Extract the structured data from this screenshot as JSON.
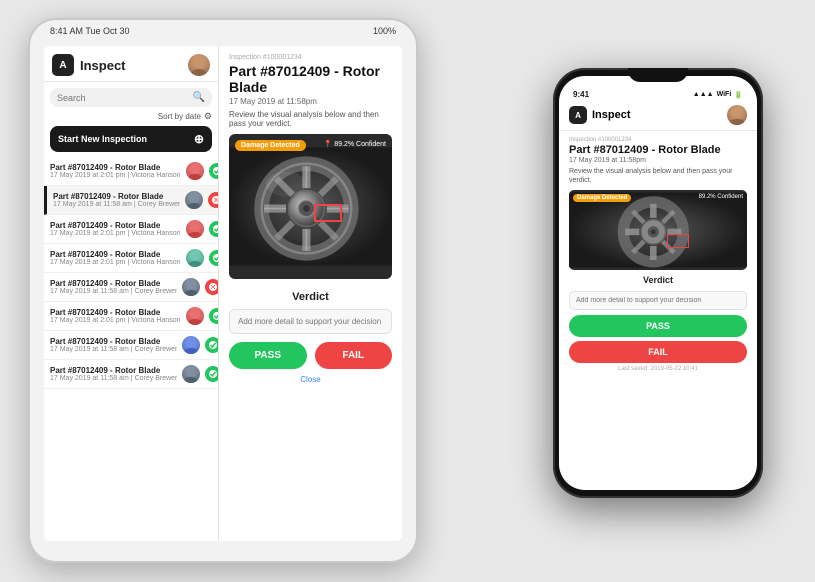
{
  "app": {
    "name": "Inspect",
    "logo": "A"
  },
  "tablet": {
    "status_bar": {
      "time": "8:41 AM  Tue Oct 30",
      "battery": "100%"
    }
  },
  "phone": {
    "status_bar": {
      "time": "9:41",
      "signal": "▲▲▲",
      "wifi": "WiFi",
      "battery": "100%"
    }
  },
  "search": {
    "placeholder": "Search",
    "sort_label": "Sort by date"
  },
  "start_inspection": {
    "label": "Start New Inspection"
  },
  "list_items": [
    {
      "title": "Part #87012409 - Rotor Blade",
      "sub": "17 May 2019 at 2:01 pm | Victoria Hanson",
      "avatar_class": "av-red",
      "status": "green",
      "active": false
    },
    {
      "title": "Part #87012409 - Rotor Blade",
      "sub": "17 May 2019 at 11:58 am | Corey Brewer",
      "avatar_class": "av-dark",
      "status": "red",
      "active": true
    },
    {
      "title": "Part #87012409 - Rotor Blade",
      "sub": "17 May 2019 at 2:01 pm | Victoria Hanson",
      "avatar_class": "av-red",
      "status": "green",
      "active": false
    },
    {
      "title": "Part #87012409 - Rotor Blade",
      "sub": "17 May 2019 at 2:01 pm | Victoria Hanson",
      "avatar_class": "av-teal",
      "status": "green",
      "active": false
    },
    {
      "title": "Part #87012409 - Rotor Blade",
      "sub": "17 May 2019 at 11:58 am | Corey Brewer",
      "avatar_class": "av-dark",
      "status": "red",
      "active": false
    },
    {
      "title": "Part #87012409 - Rotor Blade",
      "sub": "17 May 2019 at 2:01 pm | Victoria Hanson",
      "avatar_class": "av-red",
      "status": "green",
      "active": false
    },
    {
      "title": "Part #87012409 - Rotor Blade",
      "sub": "17 May 2019 at 11:58 am | Corey Brewer",
      "avatar_class": "av-blue",
      "status": "green",
      "active": false
    },
    {
      "title": "Part #87012409 - Rotor Blade",
      "sub": "17 May 2019 at 11:58 am | Corey Brewer",
      "avatar_class": "av-dark",
      "status": "green",
      "active": false
    }
  ],
  "detail": {
    "inspection_id": "Inspection #100001234",
    "part_title": "Part #87012409 - Rotor Blade",
    "date": "17 May 2019 at 11:58pm",
    "review_text": "Review the visual analysis below and then pass your verdict.",
    "damage_badge": "Damage Detected",
    "confidence": "89.2% Confident",
    "verdict_label": "Verdict",
    "verdict_placeholder": "Add more detail to support your decision here",
    "pass_label": "PASS",
    "fail_label": "FAIL",
    "close_label": "Close"
  },
  "phone_detail": {
    "inspection_id": "Inspection #100001234",
    "part_title": "Part #87012409 - Rotor Blade",
    "date": "17 May 2019 at 11:58pm",
    "review_text": "Review the visual analysis below and then pass your verdict.",
    "damage_badge": "Damage Detected",
    "confidence": "89.2% Confident",
    "verdict_label": "Verdict",
    "verdict_placeholder": "Add more detail to support your decision",
    "pass_label": "PASS",
    "fail_label": "FAIL",
    "footer_text": "Last saved: 2019-05-22 10:41"
  }
}
